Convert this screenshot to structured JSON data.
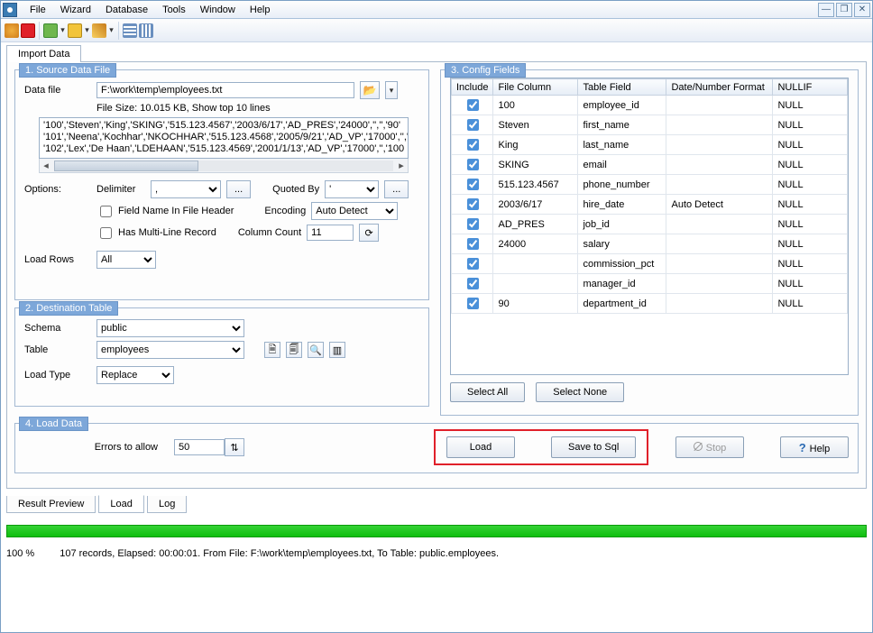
{
  "menu": {
    "items": [
      "File",
      "Wizard",
      "Database",
      "Tools",
      "Window",
      "Help"
    ]
  },
  "mainTab": "Import Data",
  "source": {
    "legend": "1. Source Data File",
    "dataFileLabel": "Data file",
    "dataFile": "F:\\work\\temp\\employees.txt",
    "fileSize": "File Size: 10.015 KB,   Show top 10 lines",
    "previewLines": [
      "'100','Steven','King','SKING','515.123.4567','2003/6/17','AD_PRES','24000','','','90'",
      "'101','Neena','Kochhar','NKOCHHAR','515.123.4568','2005/9/21','AD_VP','17000','','",
      "'102','Lex','De Haan','LDEHAAN','515.123.4569','2001/1/13','AD_VP','17000','','100"
    ],
    "optionsLabel": "Options:",
    "delimiterLabel": "Delimiter",
    "delimiter": ",",
    "ellipsis": "...",
    "quotedByLabel": "Quoted By",
    "quotedBy": "'",
    "fieldNameHeader": "Field Name In File Header",
    "encodingLabel": "Encoding",
    "encoding": "Auto Detect",
    "multiLine": "Has Multi-Line Record",
    "columnCountLabel": "Column Count",
    "columnCount": "11",
    "loadRowsLabel": "Load Rows",
    "loadRows": "All"
  },
  "dest": {
    "legend": "2. Destination Table",
    "schemaLabel": "Schema",
    "schema": "public",
    "tableLabel": "Table",
    "table": "employees",
    "loadTypeLabel": "Load Type",
    "loadType": "Replace"
  },
  "config": {
    "legend": "3. Config Fields",
    "headers": {
      "include": "Include",
      "fileCol": "File Column",
      "tableField": "Table Field",
      "fmt": "Date/Number Format",
      "nullif": "NULLIF"
    },
    "rows": [
      {
        "fc": "100",
        "tf": "employee_id",
        "fmt": "",
        "nullif": "NULL"
      },
      {
        "fc": "Steven",
        "tf": "first_name",
        "fmt": "",
        "nullif": "NULL"
      },
      {
        "fc": "King",
        "tf": "last_name",
        "fmt": "",
        "nullif": "NULL"
      },
      {
        "fc": "SKING",
        "tf": "email",
        "fmt": "",
        "nullif": "NULL"
      },
      {
        "fc": "515.123.4567",
        "tf": "phone_number",
        "fmt": "",
        "nullif": "NULL"
      },
      {
        "fc": "2003/6/17",
        "tf": "hire_date",
        "fmt": "Auto Detect",
        "nullif": "NULL"
      },
      {
        "fc": "AD_PRES",
        "tf": "job_id",
        "fmt": "",
        "nullif": "NULL"
      },
      {
        "fc": "24000",
        "tf": "salary",
        "fmt": "",
        "nullif": "NULL"
      },
      {
        "fc": "",
        "tf": "commission_pct",
        "fmt": "",
        "nullif": "NULL"
      },
      {
        "fc": "",
        "tf": "manager_id",
        "fmt": "",
        "nullif": "NULL"
      },
      {
        "fc": "90",
        "tf": "department_id",
        "fmt": "",
        "nullif": "NULL"
      }
    ],
    "selectAll": "Select All",
    "selectNone": "Select None"
  },
  "load": {
    "legend": "4. Load Data",
    "errorsLabel": "Errors to allow",
    "errors": "50",
    "loadBtn": "Load",
    "saveSqlBtn": "Save to Sql",
    "stopBtn": "Stop",
    "helpBtn": "Help"
  },
  "bottomTabs": {
    "resultPreview": "Result Preview",
    "load": "Load",
    "log": "Log"
  },
  "status": {
    "pct": "100 %",
    "msg": "107 records,    Elapsed: 00:00:01.    From File: F:\\work\\temp\\employees.txt,    To Table: public.employees."
  }
}
